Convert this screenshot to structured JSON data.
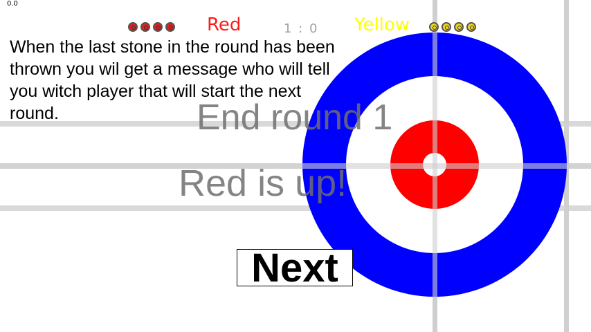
{
  "hud": {
    "corner_value": "0.0",
    "score": "1 : 0"
  },
  "players": {
    "red": {
      "label": "Red",
      "stones_remaining": 4,
      "color": "#ff1a1a"
    },
    "yellow": {
      "label": "Yellow",
      "stones_remaining": 4,
      "color": "#ffff00"
    }
  },
  "tutorial": {
    "text": "When the last stone in the round has been thrown you wil get a message who will tell you witch player that will start the next round."
  },
  "message": {
    "end_round": "End round 1",
    "next_player": "Red is up!"
  },
  "controls": {
    "next_label": "Next"
  },
  "colors": {
    "house_outer": "#0000ff",
    "house_inner": "#ff0000",
    "ice": "#ffffff",
    "lines": "#d0d0d0"
  }
}
